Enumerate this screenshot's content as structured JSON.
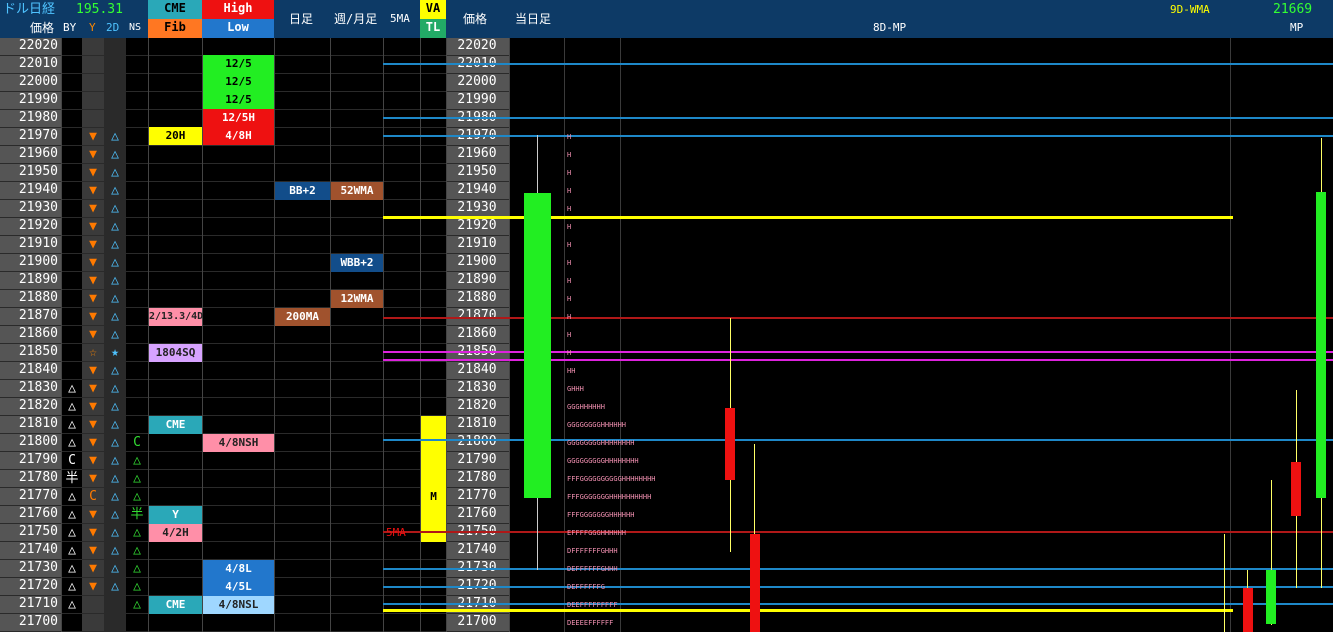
{
  "header": {
    "title": "ドル日経",
    "fx_rate": "195.31",
    "price_label": "価格",
    "by_label": "BY",
    "y_label": "Y",
    "d2_label": "2D",
    "ns_label": "NS",
    "cme_label": "CME",
    "fib_label": "Fib",
    "high_label": "High",
    "low_label": "Low",
    "daily_label": "日足",
    "weekly_label": "週/月足",
    "ma5_label": "5MA",
    "va_label": "VA",
    "tl_label": "TL",
    "price_label2": "価格",
    "today_label": "当日足",
    "mp8_label": "8D-MP",
    "wma9_label": "9D-WMA",
    "mp_value": "21669",
    "mp_label": "MP"
  },
  "prices": [
    "22020",
    "22010",
    "22000",
    "21990",
    "21980",
    "21970",
    "21960",
    "21950",
    "21940",
    "21930",
    "21920",
    "21910",
    "21900",
    "21890",
    "21880",
    "21870",
    "21860",
    "21850",
    "21840",
    "21830",
    "21820",
    "21810",
    "21800",
    "21790",
    "21780",
    "21770",
    "21760",
    "21750",
    "21740",
    "21730",
    "21720",
    "21710",
    "21700"
  ],
  "marks": {
    "by": [
      "",
      "",
      "",
      "",
      "",
      "",
      "",
      "",
      "",
      "",
      "",
      "",
      "",
      "",
      "",
      "",
      "",
      "",
      "",
      "△",
      "△",
      "△",
      "△",
      "C",
      "半",
      "△",
      "△",
      "△",
      "△",
      "△",
      "△",
      "△",
      ""
    ],
    "y": [
      "",
      "",
      "",
      "",
      "",
      "▼",
      "▼",
      "▼",
      "▼",
      "▼",
      "▼",
      "▼",
      "▼",
      "▼",
      "▼",
      "▼",
      "▼",
      "☆",
      "▼",
      "▼",
      "▼",
      "▼",
      "▼",
      "▼",
      "▼",
      "C",
      "▼",
      "▼",
      "▼",
      "▼",
      "▼",
      "",
      ""
    ],
    "d2": [
      "",
      "",
      "",
      "",
      "",
      "△",
      "△",
      "△",
      "△",
      "△",
      "△",
      "△",
      "△",
      "△",
      "△",
      "△",
      "△",
      "★",
      "△",
      "△",
      "△",
      "△",
      "△",
      "△",
      "△",
      "△",
      "△",
      "△",
      "△",
      "△",
      "△",
      "",
      ""
    ],
    "ns": [
      "",
      "",
      "",
      "",
      "",
      "",
      "",
      "",
      "",
      "",
      "",
      "",
      "",
      "",
      "",
      "",
      "",
      "",
      "",
      "",
      "",
      "",
      "C",
      "△",
      "△",
      "△",
      "半",
      "△",
      "△",
      "△",
      "△",
      "△",
      ""
    ]
  },
  "colors": {
    "header_bg": "#0d3a66",
    "up_candle": "#22ee22",
    "down_candle": "#ee1111",
    "yellow": "#ffff00",
    "magenta": "#dd22dd",
    "blue_line": "#1e88c8",
    "red_line": "#b01818"
  },
  "labels": {
    "cme_20h": "20H",
    "fib_ratio": "2/13.3/4D",
    "sq": "1804SQ",
    "cme_row": "CME",
    "y_box": "Y",
    "h42": "4/2H",
    "cme_bottom": "CME",
    "high_12_5_a": "12/5",
    "high_12_5_b": "12/5",
    "high_12_5_c": "12/5",
    "high_12_5h": "12/5H",
    "high_4_8h": "4/8H",
    "nsh": "4/8NSH",
    "l48": "4/8L",
    "l45": "4/5L",
    "nsl": "4/8NSL",
    "bb2": "BB+2",
    "ma200": "200MA",
    "wma52": "52WMA",
    "wbb2": "WBB+2",
    "wma12": "12WMA",
    "ma5_marker": "5MA",
    "m_marker": "M"
  },
  "tpo": [
    {
      "row": 5,
      "text": "H"
    },
    {
      "row": 6,
      "text": "H"
    },
    {
      "row": 7,
      "text": "H"
    },
    {
      "row": 8,
      "text": "H"
    },
    {
      "row": 9,
      "text": "H"
    },
    {
      "row": 10,
      "text": "H"
    },
    {
      "row": 11,
      "text": "H"
    },
    {
      "row": 12,
      "text": "H"
    },
    {
      "row": 13,
      "text": "H"
    },
    {
      "row": 14,
      "text": "H"
    },
    {
      "row": 15,
      "text": "H"
    },
    {
      "row": 16,
      "text": "H"
    },
    {
      "row": 17,
      "text": "H"
    },
    {
      "row": 18,
      "text": "HH"
    },
    {
      "row": 19,
      "text": "GHHH"
    },
    {
      "row": 20,
      "text": "GGGHHHHHH"
    },
    {
      "row": 21,
      "text": "GGGGGGGGHHHHHH"
    },
    {
      "row": 22,
      "text": "GGGGGGGGHHHHHHHH"
    },
    {
      "row": 23,
      "text": "GGGGGGGGGHHHHHHHH"
    },
    {
      "row": 24,
      "text": "FFFGGGGGGGGGGHHHHHHHH"
    },
    {
      "row": 25,
      "text": "FFFGGGGGGGHHHHHHHHHH"
    },
    {
      "row": 26,
      "text": "FFFGGGGGGGHHHHHH"
    },
    {
      "row": 27,
      "text": "EFFFFGGGHHHHHH"
    },
    {
      "row": 28,
      "text": "DFFFFFFFGHHH"
    },
    {
      "row": 29,
      "text": "DEFFFFFFGHHH"
    },
    {
      "row": 30,
      "text": "DEFFFFFFG"
    },
    {
      "row": 31,
      "text": "DEEFFFFFFFFF"
    },
    {
      "row": 32,
      "text": "DEEEEFFFFFF"
    }
  ]
}
